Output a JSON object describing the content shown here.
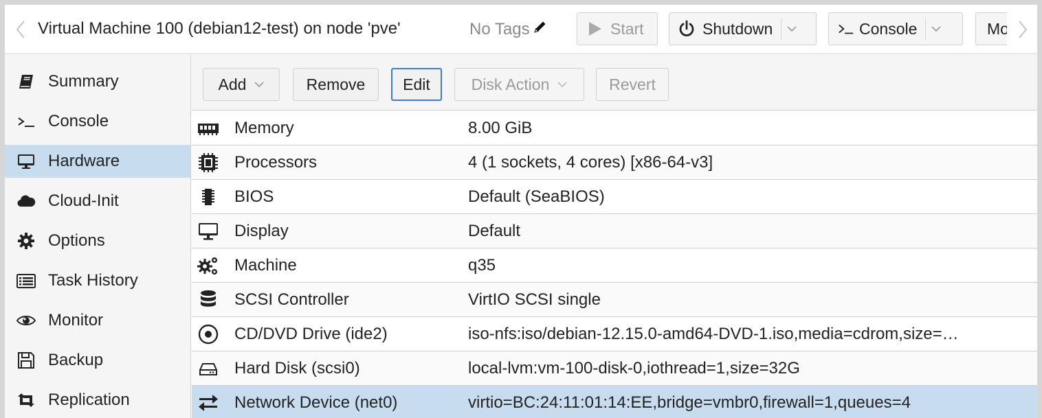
{
  "header": {
    "title": "Virtual Machine 100 (debian12-test) on node 'pve'",
    "tags": "No Tags",
    "buttons": {
      "start": "Start",
      "shutdown": "Shutdown",
      "console": "Console",
      "more": "More"
    }
  },
  "sidebar": {
    "items": [
      {
        "label": "Summary",
        "icon": "book-icon"
      },
      {
        "label": "Console",
        "icon": "terminal-icon"
      },
      {
        "label": "Hardware",
        "icon": "desktop-icon",
        "active": true
      },
      {
        "label": "Cloud-Init",
        "icon": "cloud-icon"
      },
      {
        "label": "Options",
        "icon": "gear-icon"
      },
      {
        "label": "Task History",
        "icon": "list-icon"
      },
      {
        "label": "Monitor",
        "icon": "eye-icon"
      },
      {
        "label": "Backup",
        "icon": "floppy-icon"
      },
      {
        "label": "Replication",
        "icon": "retweet-icon"
      }
    ]
  },
  "toolbar": {
    "add": "Add",
    "remove": "Remove",
    "edit": "Edit",
    "disk_action": "Disk Action",
    "revert": "Revert"
  },
  "hardware": {
    "rows": [
      {
        "name": "Memory",
        "value": "8.00 GiB",
        "icon": "memory-icon"
      },
      {
        "name": "Processors",
        "value": "4 (1 sockets, 4 cores) [x86-64-v3]",
        "icon": "cpu-icon"
      },
      {
        "name": "BIOS",
        "value": "Default (SeaBIOS)",
        "icon": "microchip-icon"
      },
      {
        "name": "Display",
        "value": "Default",
        "icon": "desktop-icon"
      },
      {
        "name": "Machine",
        "value": "q35",
        "icon": "cogs-icon"
      },
      {
        "name": "SCSI Controller",
        "value": "VirtIO SCSI single",
        "icon": "database-icon"
      },
      {
        "name": "CD/DVD Drive (ide2)",
        "value": "iso-nfs:iso/debian-12.15.0-amd64-DVD-1.iso,media=cdrom,size=…",
        "icon": "cdrom-icon"
      },
      {
        "name": "Hard Disk (scsi0)",
        "value": "local-lvm:vm-100-disk-0,iothread=1,size=32G",
        "icon": "hdd-icon"
      },
      {
        "name": "Network Device (net0)",
        "value": "virtio=BC:24:11:01:14:EE,bridge=vmbr0,firewall=1,queues=4",
        "icon": "exchange-icon",
        "selected": true
      }
    ]
  },
  "colors": {
    "selection": "#c8dcef",
    "focus_border": "#3a7bd5",
    "sidebar_bg": "#f5f5f5"
  }
}
